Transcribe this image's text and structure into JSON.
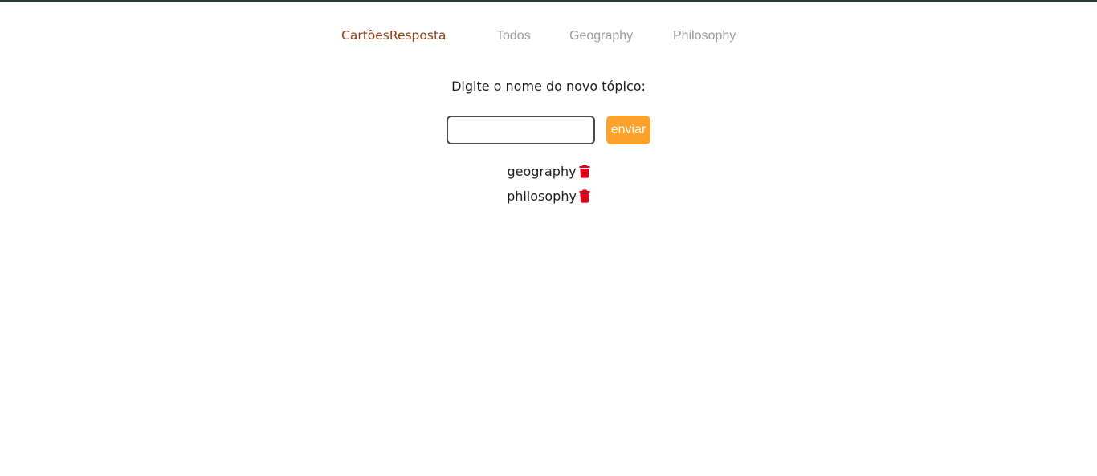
{
  "nav": {
    "brand_part1": "Cartões",
    "brand_part2": "Resposta",
    "links": [
      "Todos",
      "Geography",
      "Philosophy"
    ]
  },
  "form": {
    "prompt": "Digite o nome do novo tópico:",
    "input_value": "",
    "submit_label": "enviar"
  },
  "topics": [
    {
      "name": "geography",
      "action_icon": "trash-icon"
    },
    {
      "name": "philosophy",
      "action_icon": "trash-icon"
    }
  ],
  "colors": {
    "brand": "#8a3d13",
    "nav_link": "#9a9a9a",
    "button": "#ffa22b",
    "delete_icon": "#e0001b"
  }
}
